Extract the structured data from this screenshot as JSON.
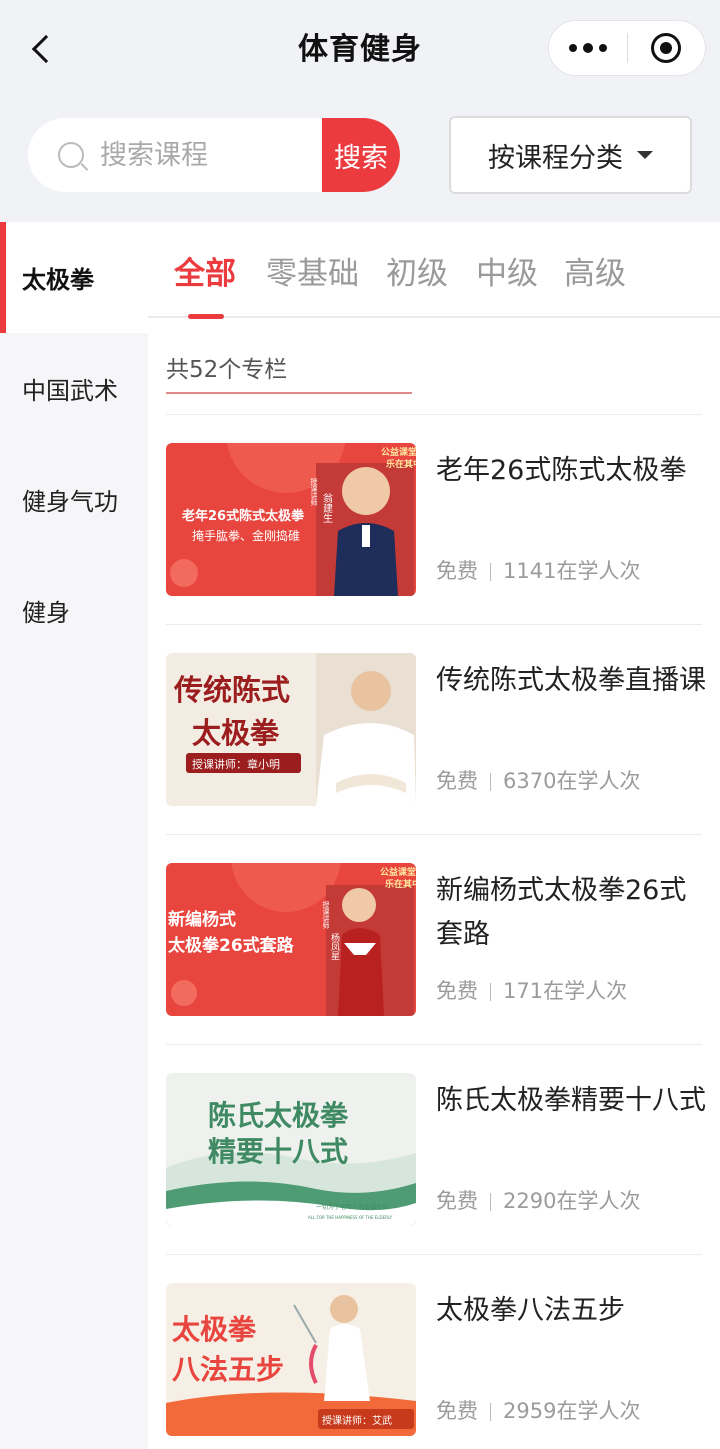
{
  "nav": {
    "title": "体育健身"
  },
  "search": {
    "placeholder": "搜索课程",
    "button": "搜索"
  },
  "category_select": {
    "label": "按课程分类"
  },
  "sidebar": {
    "items": [
      {
        "label": "太极拳",
        "active": true
      },
      {
        "label": "中国武术",
        "active": false
      },
      {
        "label": "健身气功",
        "active": false
      },
      {
        "label": "健身",
        "active": false
      }
    ]
  },
  "tabs": [
    {
      "label": "全部",
      "active": true
    },
    {
      "label": "零基础",
      "active": false
    },
    {
      "label": "初级",
      "active": false
    },
    {
      "label": "中级",
      "active": false
    },
    {
      "label": "高级",
      "active": false
    }
  ],
  "count_text": "共52个专栏",
  "courses": [
    {
      "title": "老年26式陈式太极拳",
      "price": "免费",
      "learners": "1141在学人次",
      "thumb": {
        "line1": "老年26式陈式太极拳",
        "line2": "掩手肱拳、金刚捣碓",
        "teacher_label": "授课讲师",
        "teacher": "翁建生",
        "badge1": "公益课堂",
        "badge2": "乐在其中"
      }
    },
    {
      "title": "传统陈式太极拳直播课",
      "price": "免费",
      "learners": "6370在学人次",
      "thumb": {
        "line1": "传统陈式",
        "line2": "太极拳",
        "teacher": "授课讲师：章小明"
      }
    },
    {
      "title": "新编杨式太极拳26式套路",
      "price": "免费",
      "learners": "171在学人次",
      "thumb": {
        "line1": "新编杨式",
        "line2": "太极拳26式套路",
        "teacher_label": "授课讲师",
        "teacher": "杨凤星",
        "badge1": "公益课堂",
        "badge2": "乐在其中"
      }
    },
    {
      "title": "陈氏太极拳精要十八式",
      "price": "免费",
      "learners": "2290在学人次",
      "thumb": {
        "line1": "陈氏太极拳",
        "line2": "精要十八式",
        "caption": "一切为了老年人的幸福生活",
        "caption_en": "ALL FOR THE HAPPINESS OF THE ELDERLY"
      }
    },
    {
      "title": "太极拳八法五步",
      "price": "免费",
      "learners": "2959在学人次",
      "thumb": {
        "line1": "太极拳",
        "line2": "八法五步",
        "teacher": "授课讲师：艾武"
      }
    }
  ],
  "colors": {
    "accent": "#ec3b3f",
    "nav_bg": "#f1f2f6",
    "sidebar_bg": "#f6f6f8"
  },
  "icons": {
    "back": "chevron-left-icon",
    "more": "more-dots-icon",
    "close": "target-circle-icon",
    "search": "magnifier-icon",
    "dropdown": "caret-down-icon"
  }
}
